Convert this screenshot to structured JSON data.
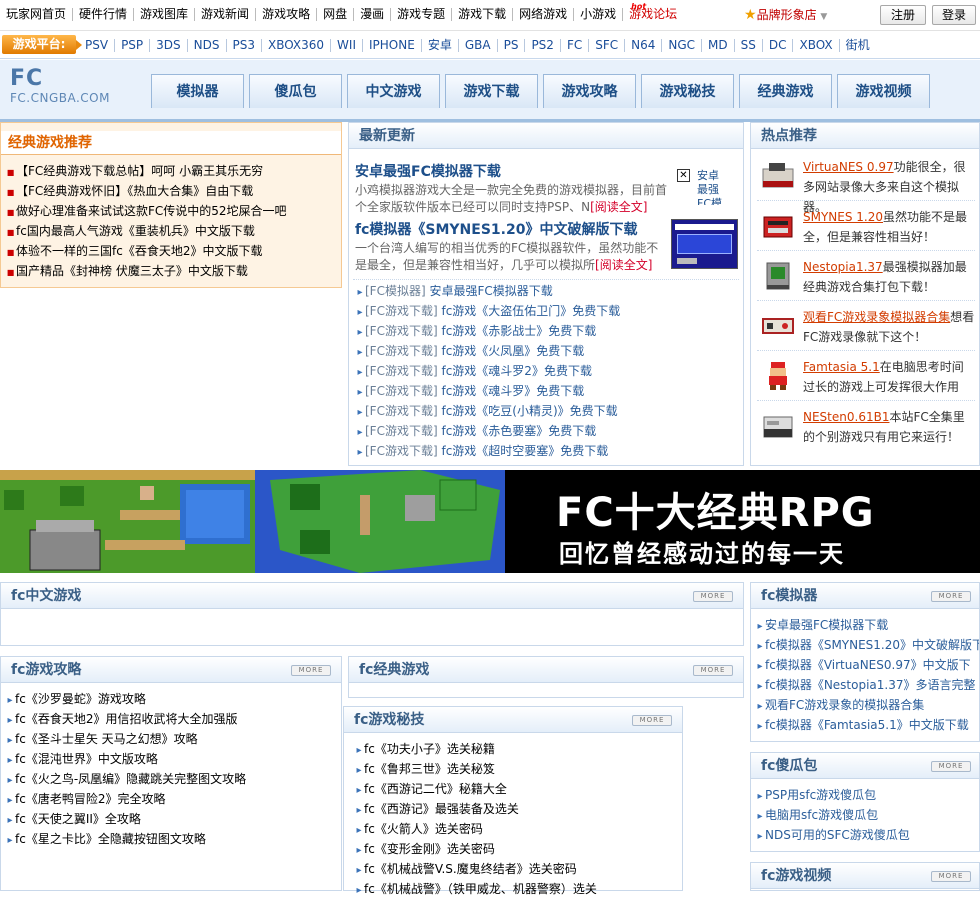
{
  "topnav": {
    "items": [
      "玩家网首页",
      "硬件行情",
      "游戏图库",
      "游戏新闻",
      "游戏攻略",
      "网盘",
      "漫画",
      "游戏专题",
      "游戏下载",
      "网络游戏",
      "小游戏"
    ],
    "forum": "游戏论坛",
    "forum_badge": "hot",
    "brand": "品牌形象店",
    "register": "注册",
    "login": "登录"
  },
  "platform": {
    "label": "游戏平台:",
    "links": [
      "PSV",
      "PSP",
      "3DS",
      "NDS",
      "PS3",
      "XBOX360",
      "WII",
      "IPHONE",
      "安卓",
      "GBA",
      "PS",
      "PS2",
      "FC",
      "SFC",
      "N64",
      "NGC",
      "MD",
      "SS",
      "DC",
      "XBOX",
      "街机"
    ]
  },
  "header": {
    "logo": "FC",
    "logo_url": "FC.CNGBA.COM",
    "tabs": [
      "模拟器",
      "傻瓜包",
      "中文游戏",
      "游戏下载",
      "游戏攻略",
      "游戏秘技",
      "经典游戏",
      "游戏视频"
    ]
  },
  "classic": {
    "title": "经典游戏推荐",
    "items": [
      "【FC经典游戏下载总帖】呵呵 小霸王其乐无穷",
      "【FC经典游戏怀旧】《热血大合集》自由下载",
      "做好心理准备来试试这款FC传说中的52坨屎合一吧",
      "fc国内最高人气游戏《重装机兵》中文版下载",
      "体验不一样的三国fc《吞食天地2》中文版下载",
      "国产精品《封神榜 伏魔三太子》中文版下载"
    ]
  },
  "latest": {
    "title": "最新更新",
    "feature1": {
      "title": "安卓最强FC模拟器下载",
      "desc": "小鸡模拟器游戏大全是一款完全免费的游戏模拟器，目前首个全家版软件版本已经可以同时支持PSP、N",
      "more": "[阅读全文]",
      "thumb_alt": "安卓最强FC模"
    },
    "feature2": {
      "title": "fc模拟器《SMYNES1.20》中文破解版下载",
      "desc": "一个台湾人编写的相当优秀的FC模拟器软件，虽然功能不是最全，但是兼容性相当好，几乎可以模拟所",
      "more": "[阅读全文]"
    },
    "list": [
      {
        "cat": "[FC模拟器]",
        "text": "安卓最强FC模拟器下载"
      },
      {
        "cat": "[FC游戏下载]",
        "text": "fc游戏《大盗伍佑卫门》免费下载"
      },
      {
        "cat": "[FC游戏下载]",
        "text": "fc游戏《赤影战士》免费下载"
      },
      {
        "cat": "[FC游戏下载]",
        "text": "fc游戏《火凤凰》免费下载"
      },
      {
        "cat": "[FC游戏下载]",
        "text": "fc游戏《魂斗罗2》免费下载"
      },
      {
        "cat": "[FC游戏下载]",
        "text": "fc游戏《魂斗罗》免费下载"
      },
      {
        "cat": "[FC游戏下载]",
        "text": "fc游戏《吃豆(小精灵)》免费下载"
      },
      {
        "cat": "[FC游戏下载]",
        "text": "fc游戏《赤色要塞》免费下载"
      },
      {
        "cat": "[FC游戏下载]",
        "text": "fc游戏《超时空要塞》免费下载"
      }
    ]
  },
  "hot": {
    "title": "热点推荐",
    "items": [
      {
        "name": "VirtuaNES 0.97",
        "desc": "功能很全，很多网站录像大多来自这个模拟器。"
      },
      {
        "name": "SMYNES 1.20",
        "desc": "虽然功能不是最全，但是兼容性相当好！"
      },
      {
        "name": "Nestopia1.37",
        "desc": "最强模拟器加最经典游戏合集打包下载！"
      },
      {
        "name": "观看FC游戏录象模拟器合集",
        "desc": "想看FC游戏录像就下这个！"
      },
      {
        "name": "Famtasia 5.1",
        "desc": "在电脑思考时间过长的游戏上可发挥很大作用"
      },
      {
        "name": "NESten0.61B1",
        "desc": "本站FC全集里的个别游戏只有用它来运行！"
      }
    ]
  },
  "banner": {
    "line1": "FC十大经典RPG",
    "line2": "回忆曾经感动过的每一天"
  },
  "more_label": "MORE",
  "chinese_games": {
    "title": "fc中文游戏"
  },
  "guides": {
    "title": "fc游戏攻略",
    "items": [
      "fc《沙罗曼蛇》游戏攻略",
      "fc《吞食天地2》用信招收武将大全加强版",
      "fc《圣斗士星矢 天马之幻想》攻略",
      "fc《混沌世界》中文版攻略",
      "fc《火之鸟-凤凰编》隐藏跳关完整图文攻略",
      "fc《唐老鸭冒险2》完全攻略",
      "fc《天使之翼II》全攻略",
      "fc《星之卡比》全隐藏按钮图文攻略"
    ]
  },
  "classic_games": {
    "title": "fc经典游戏"
  },
  "cheats": {
    "title": "fc游戏秘技",
    "items": [
      "fc《功夫小子》选关秘籍",
      "fc《鲁邦三世》选关秘笈",
      "fc《西游记二代》秘籍大全",
      "fc《西游记》最强装备及选关",
      "fc《火箭人》选关密码",
      "fc《变形金刚》选关密码",
      "fc《机械战警V.S.魔鬼终结者》选关密码",
      "fc《机械战警》（铁甲威龙、机器警察）选关"
    ]
  },
  "emulators": {
    "title": "fc模拟器",
    "items": [
      "安卓最强FC模拟器下载",
      "fc模拟器《SMYNES1.20》中文破解版下",
      "fc模拟器《VirtuaNES0.97》中文版下",
      "fc模拟器《Nestopia1.37》多语言完整",
      "观看FC游戏录象的模拟器合集",
      "fc模拟器《Famtasia5.1》中文版下载"
    ]
  },
  "packs": {
    "title": "fc傻瓜包",
    "items": [
      "PSP用sfc游戏傻瓜包",
      "电脑用sfc游戏傻瓜包",
      "NDS可用的SFC游戏傻瓜包"
    ]
  },
  "videos": {
    "title": "fc游戏视频"
  }
}
